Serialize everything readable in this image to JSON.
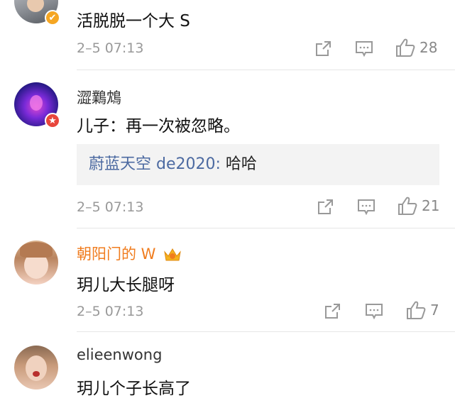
{
  "comments": [
    {
      "username": "",
      "text": "活脱脱一个大 S",
      "time": "2–5 07:13",
      "likes": "28",
      "badge": "✔",
      "badge_color": "#f5a623"
    },
    {
      "username": "澀鸈鴆",
      "text": "儿子：再一次被忽略。",
      "reply_name": "蔚蓝天空 de2020:",
      "reply_text": " 哈哈",
      "time": "2–5 07:13",
      "likes": "21",
      "badge": "★",
      "badge_color": "#e8463c"
    },
    {
      "username": "朝阳门的 W",
      "text": "玥儿大长腿呀",
      "time": "2–5 07:13",
      "likes": "7",
      "username_color": "#f07c1e"
    },
    {
      "username": "elieenwong",
      "text": "玥儿个子长高了"
    }
  ],
  "icons": {
    "share": "share-icon",
    "comment": "comment-icon",
    "like": "thumbs-up-icon",
    "crown": "crown-icon"
  }
}
